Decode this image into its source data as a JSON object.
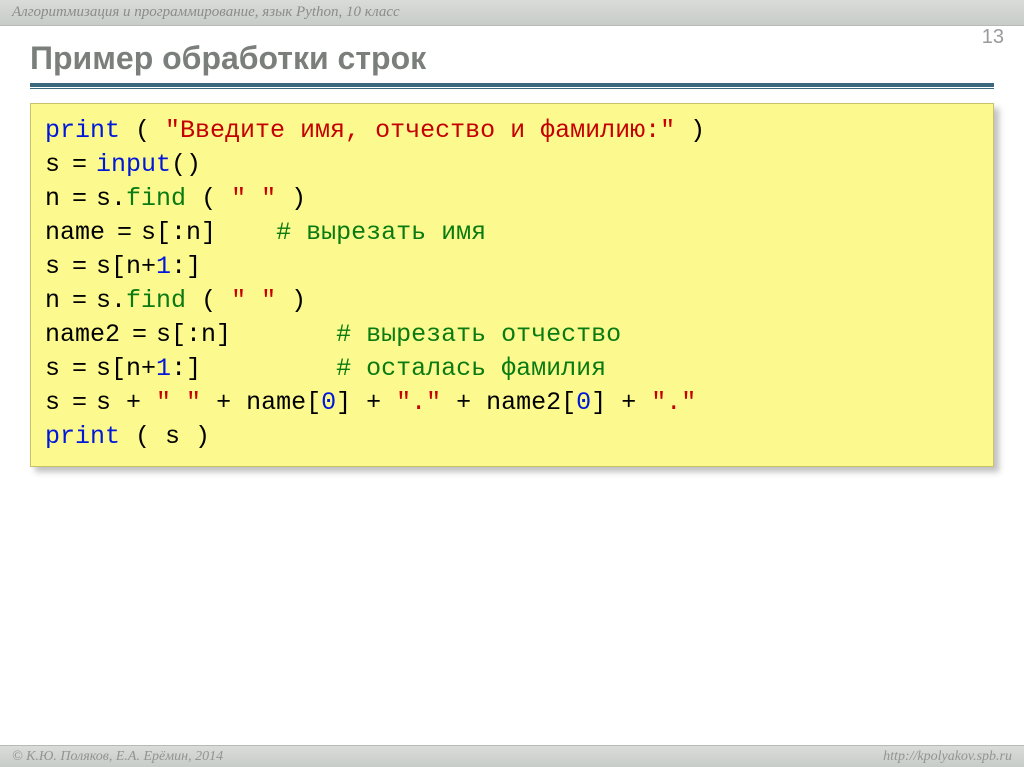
{
  "header": {
    "course": "Алгоритмизация и программирование, язык Python, 10 класс"
  },
  "page_number": "13",
  "title": "Пример обработки строк",
  "code": {
    "l1": {
      "print": "print",
      "lp": " ( ",
      "str": "\"Введите имя, отчество и фамилию:\"",
      "rp": " )"
    },
    "l2": {
      "a": "s",
      "eq": " = ",
      "input": "input",
      "p": "()"
    },
    "l3": {
      "a": "n",
      "eq": " = ",
      "b": "s.",
      "find": "find",
      "p1": " ( ",
      "str": "\" \"",
      "p2": " )"
    },
    "l4": {
      "a": "name",
      "eq": " = ",
      "b": "s[:n]    ",
      "c": "# вырезать имя"
    },
    "l5": {
      "a": "s",
      "eq": " = ",
      "b": "s[n+",
      "one": "1",
      "c": ":]"
    },
    "l6": {
      "a": "n",
      "eq": " = ",
      "b": "s.",
      "find": "find",
      "p1": " ( ",
      "str": "\" \"",
      "p2": " )"
    },
    "l7": {
      "a": "name2",
      "eq": " = ",
      "b": "s[:n]       ",
      "c": "# вырезать отчество"
    },
    "l8": {
      "a": "s",
      "eq": " = ",
      "b": "s[n+",
      "one": "1",
      "c": ":]         ",
      "d": "# осталась фамилия"
    },
    "l9": {
      "a": "s",
      "eq": " = ",
      "b": "s + ",
      "s1": "\" \"",
      "c": " + name[",
      "z1": "0",
      "d": "] + ",
      "s2": "\".\"",
      "e": " + name2[",
      "z2": "0",
      "f": "] + ",
      "s3": "\".\""
    },
    "l10": {
      "print": "print",
      "p": " ( s )"
    }
  },
  "footer": {
    "left": "© К.Ю. Поляков, Е.А. Ерёмин, 2014",
    "right": "http://kpolyakov.spb.ru"
  }
}
